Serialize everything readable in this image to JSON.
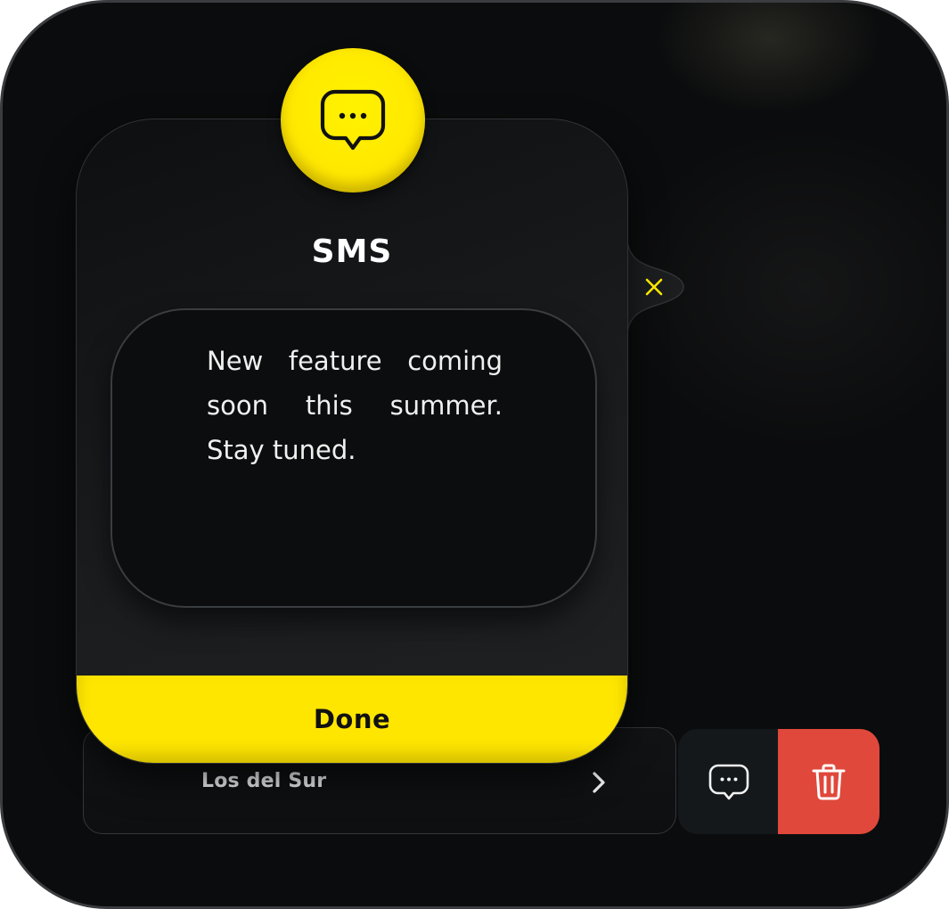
{
  "modal": {
    "title": "SMS",
    "message": "New feature coming soon this summer. Stay tuned.",
    "done_label": "Done",
    "badge_icon": "message-dots-icon",
    "close_icon": "close-icon"
  },
  "list": {
    "items": [
      {
        "label": "Los del Sur",
        "chevron_icon": "chevron-right-icon"
      }
    ]
  },
  "row_actions": {
    "message_icon": "message-dots-icon",
    "delete_icon": "trash-icon"
  },
  "colors": {
    "accent": "#ffe600",
    "danger": "#e0483b",
    "background": "#0b0c0d",
    "text": "#ffffff"
  }
}
